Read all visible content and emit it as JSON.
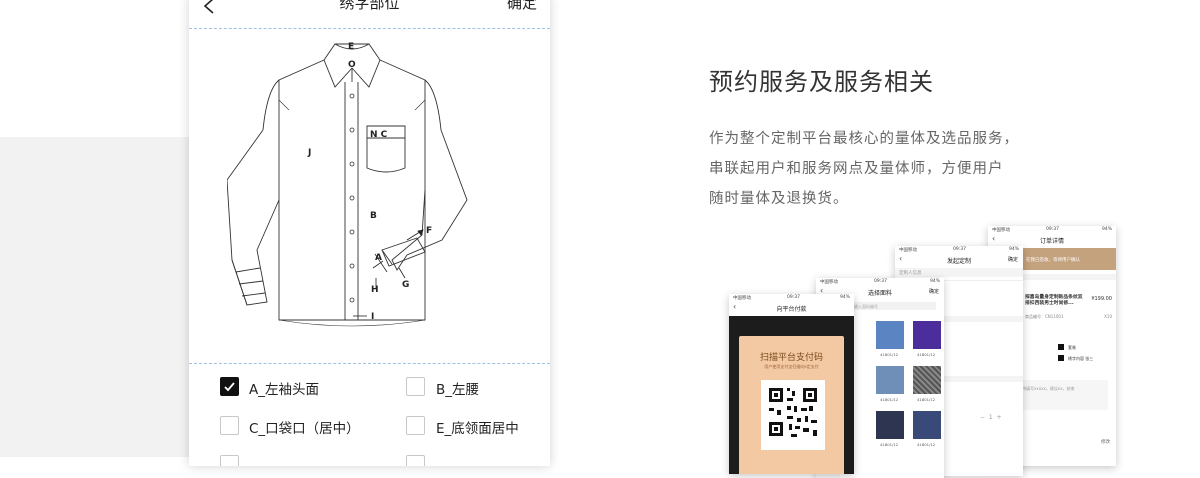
{
  "phone": {
    "title": "绣字部位",
    "confirm": "确定",
    "diagram_labels": [
      "E",
      "O",
      "N C",
      "J",
      "B",
      "A",
      "F",
      "H",
      "G",
      "I"
    ],
    "options": [
      {
        "label": "A_左袖头面",
        "checked": true
      },
      {
        "label": "B_左腰",
        "checked": false
      },
      {
        "label": "C_口袋口（居中）",
        "checked": false
      },
      {
        "label": "E_底领面居中",
        "checked": false
      }
    ]
  },
  "section": {
    "heading": "预约服务及服务相关",
    "desc_lines": [
      "作为整个定制平台最核心的量体及选品服务，",
      "串联起用户和服务网点及量体师，方便用户",
      "随时量体及退换货。"
    ]
  },
  "mini1": {
    "carrier": "中国移动",
    "time": "09:37",
    "battery": "94%",
    "title": "向平台付款",
    "pay_title": "扫描平台支付码",
    "pay_sub": "用户使用支付宝扫描向e定支付"
  },
  "mini2": {
    "carrier": "中国移动",
    "time": "09:37",
    "battery": "94%",
    "title": "选择面料",
    "confirm": "确定",
    "search": "请输入面料编号",
    "codes": [
      "41801/12",
      "41801/12",
      "41801/12",
      "41801/12",
      "41801/12",
      "41801/12"
    ]
  },
  "mini3": {
    "carrier": "中国移动",
    "time": "09:37",
    "battery": "94%",
    "title": "发起定制",
    "confirm": "确定",
    "field": "定制人信息"
  },
  "mini4": {
    "carrier": "中国移动",
    "time": "09:37",
    "battery": "94%",
    "title": "订单详情",
    "banner": "在我已签收，等待用户确认",
    "product": "探喜岛量身定制新品条纹双排扣西装男士时尚修...",
    "price": "¥199.00",
    "sku": "商品编号：CN11001",
    "qty": "X10",
    "pkg": "套装",
    "embroidery": "绣字内容 张三",
    "note": "待填写xxxxx，建议xx，结束",
    "action": "修改",
    "step_qty": "1"
  },
  "colors": {
    "accent": "#c4a27d",
    "dark": "#1c1c1c",
    "fabric_blue": "#5a85c2",
    "fabric_purple": "#4b2e9c",
    "fabric_navy": "#2e3550"
  }
}
